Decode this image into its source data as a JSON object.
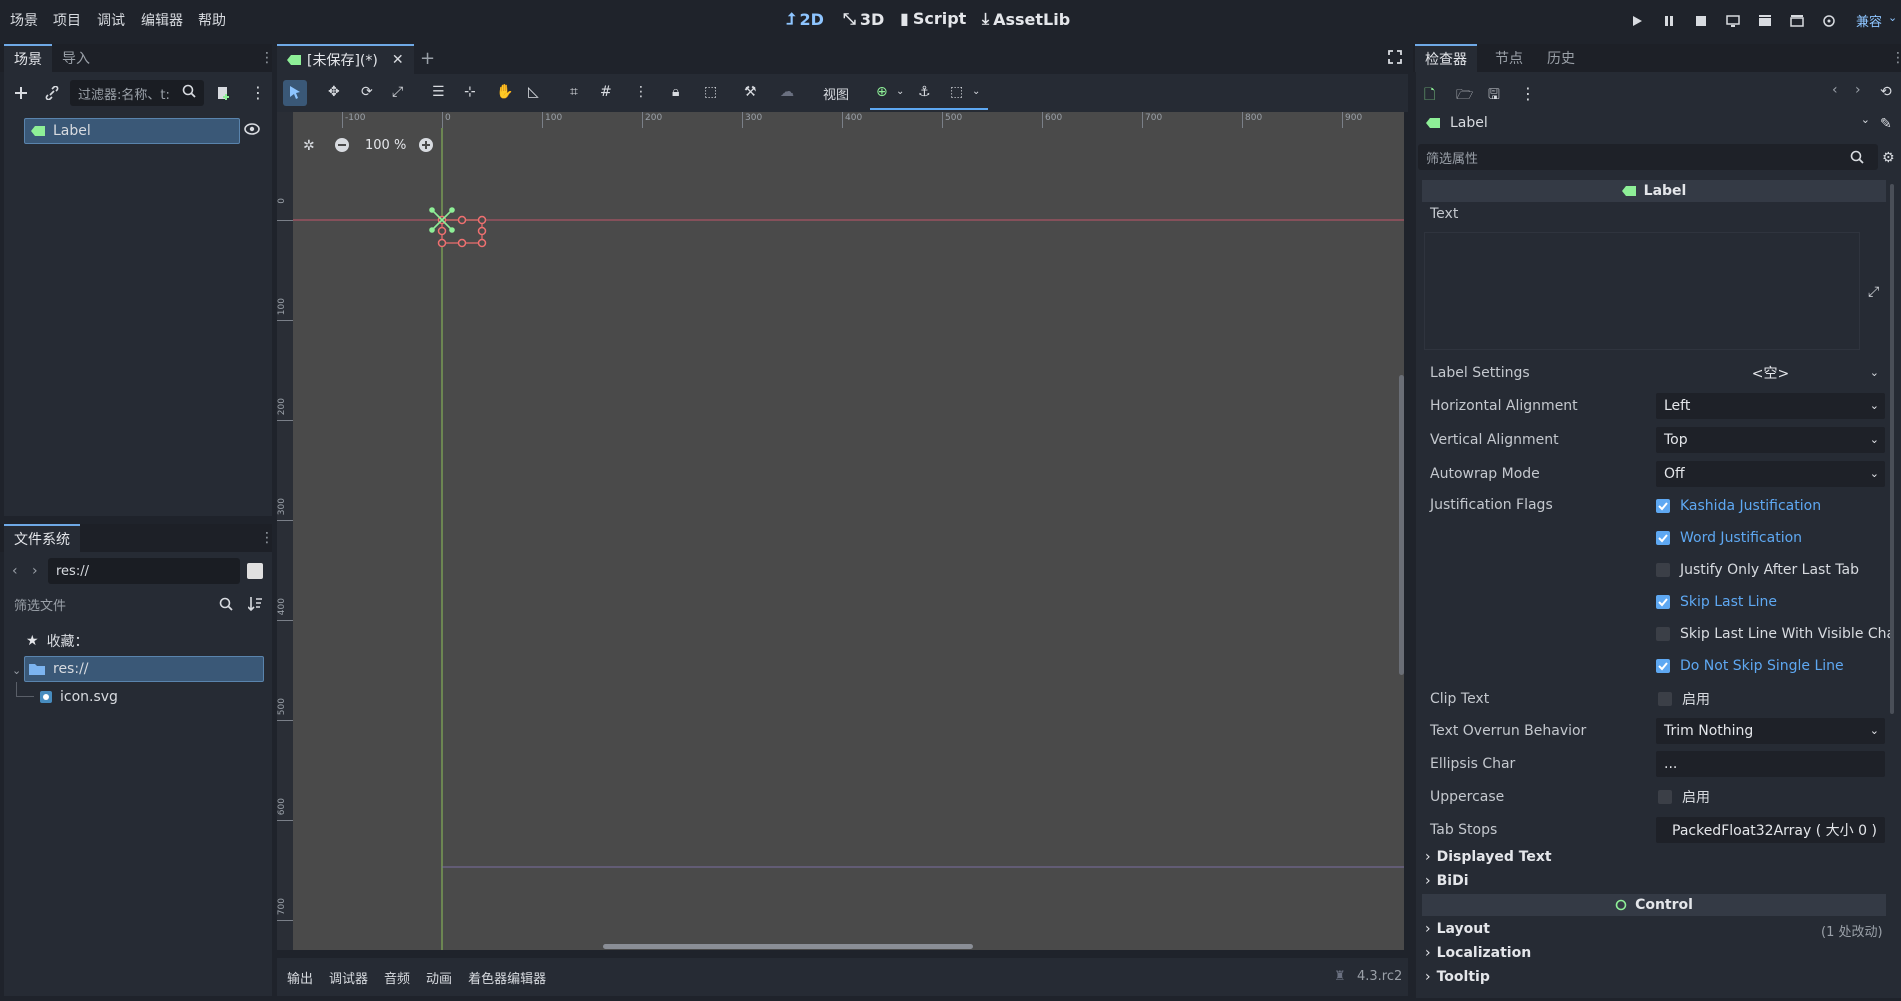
{
  "menu": [
    "场景",
    "项目",
    "调试",
    "编辑器",
    "帮助"
  ],
  "workspaces": {
    "w2d": "2D",
    "w3d": "3D",
    "script": "Script",
    "assetlib": "AssetLib"
  },
  "renderer": "兼容",
  "scene_dock": {
    "tabs": [
      "场景",
      "导入"
    ],
    "filter_placeholder": "过滤器:名称、t:",
    "root_node": "Label"
  },
  "filesystem_dock": {
    "tab": "文件系统",
    "path": "res://",
    "filter_placeholder": "筛选文件",
    "favorites": "收藏：",
    "root": "res://",
    "file": "icon.svg"
  },
  "editor_tab": {
    "title": "[未保存](*)"
  },
  "toolbar": {
    "view_label": "视图"
  },
  "viewport": {
    "zoom": "100 %",
    "ruler_x": [
      "-100",
      "0",
      "100",
      "200",
      "300",
      "400",
      "500",
      "600",
      "700",
      "800",
      "900"
    ],
    "ruler_y": [
      "0",
      "100",
      "200",
      "300",
      "400",
      "500",
      "600",
      "700"
    ]
  },
  "bottom_panel": {
    "tabs": [
      "输出",
      "调试器",
      "音频",
      "动画",
      "着色器编辑器"
    ],
    "version": "4.3.rc2"
  },
  "inspector": {
    "tabs": [
      "检查器",
      "节点",
      "历史"
    ],
    "node_selector": "Label",
    "filter_placeholder": "筛选属性",
    "class_header": "Label",
    "text_label": "Text",
    "text_value": "",
    "label_settings": {
      "label": "Label Settings",
      "value": "<空>"
    },
    "horizontal_alignment": {
      "label": "Horizontal Alignment",
      "value": "Left"
    },
    "vertical_alignment": {
      "label": "Vertical Alignment",
      "value": "Top"
    },
    "autowrap_mode": {
      "label": "Autowrap Mode",
      "value": "Off"
    },
    "justification_flags": {
      "label": "Justification Flags",
      "flags": [
        {
          "label": "Kashida Justification",
          "checked": true
        },
        {
          "label": "Word Justification",
          "checked": true
        },
        {
          "label": "Justify Only After Last Tab",
          "checked": false
        },
        {
          "label": "Skip Last Line",
          "checked": true
        },
        {
          "label": "Skip Last Line With Visible Cha",
          "checked": false
        },
        {
          "label": "Do Not Skip Single Line",
          "checked": true
        }
      ]
    },
    "clip_text": {
      "label": "Clip Text",
      "value": "启用"
    },
    "text_overrun": {
      "label": "Text Overrun Behavior",
      "value": "Trim Nothing"
    },
    "ellipsis_char": {
      "label": "Ellipsis Char",
      "value": "..."
    },
    "uppercase": {
      "label": "Uppercase",
      "value": "启用"
    },
    "tab_stops": {
      "label": "Tab Stops",
      "value": "PackedFloat32Array ( 大小 0 )"
    },
    "sections": [
      "Displayed Text",
      "BiDi"
    ],
    "control_header": "Control",
    "control_sections": [
      "Layout",
      "Localization",
      "Tooltip"
    ],
    "layout_note": "(1 处改动)"
  },
  "colors": {
    "accent": "#5ea8f2",
    "node_green": "#8eef97",
    "selection": "#3a5877"
  }
}
